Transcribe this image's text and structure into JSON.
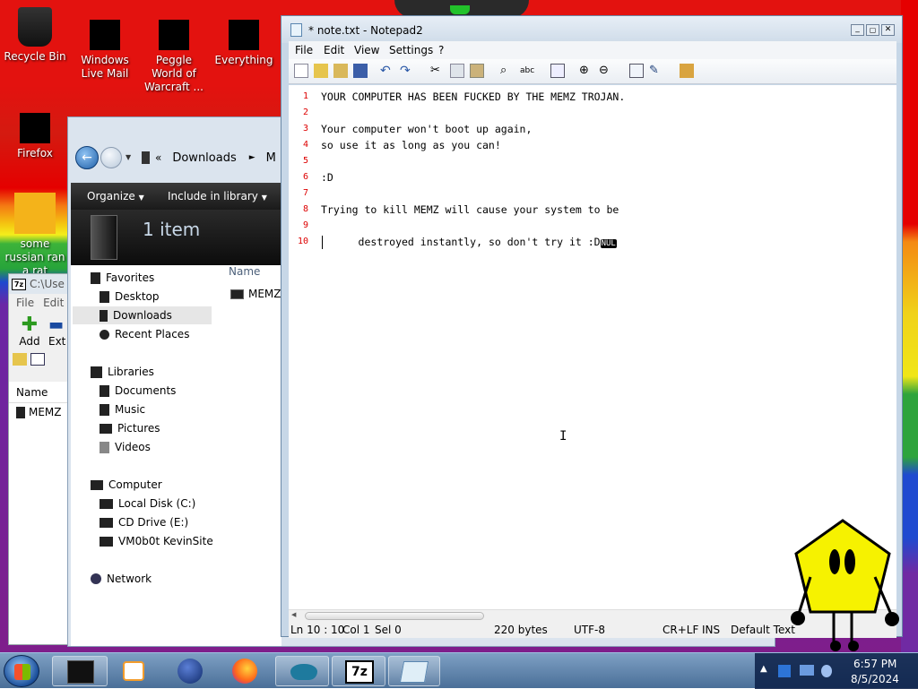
{
  "desktop": {
    "icons": [
      {
        "label": "Recycle Bin"
      },
      {
        "label": "Windows Live Mail"
      },
      {
        "label": "Peggle World of Warcraft ..."
      },
      {
        "label": "Everything"
      },
      {
        "label": "Firefox"
      },
      {
        "label": "some russian ran a rat"
      }
    ]
  },
  "explorer": {
    "breadcrumb": [
      "Downloads",
      "M"
    ],
    "cmd": {
      "organize": "Organize",
      "include": "Include in library"
    },
    "item_count": "1 item",
    "column_name": "Name",
    "files": [
      "MEMZ"
    ],
    "nav": {
      "favorites": "Favorites",
      "favorites_items": [
        "Desktop",
        "Downloads",
        "Recent Places"
      ],
      "libraries": "Libraries",
      "libraries_items": [
        "Documents",
        "Music",
        "Pictures",
        "Videos"
      ],
      "computer": "Computer",
      "computer_items": [
        "Local Disk (C:)",
        "CD Drive (E:)",
        "VM0b0t KevinSite"
      ],
      "network": "Network"
    }
  },
  "sevenzip": {
    "title": "C:\\Use",
    "menu": [
      "File",
      "Edit"
    ],
    "add": "Add",
    "extract": "Ext",
    "column_name": "Name",
    "files": [
      "MEMZ"
    ]
  },
  "notepad": {
    "title": "* note.txt - Notepad2",
    "menu": [
      "File",
      "Edit",
      "View",
      "Settings",
      "?"
    ],
    "lines": [
      "YOUR COMPUTER HAS BEEN FUCKED BY THE MEMZ TROJAN.",
      "",
      "Your computer won't boot up again,",
      "so use it as long as you can!",
      "",
      ":D",
      "",
      "Trying to kill MEMZ will cause your system to be",
      "destroyed instantly, so don't try it :D",
      ""
    ],
    "nul_marker": "NUL",
    "line_numbers": [
      "1",
      "2",
      "3",
      "4",
      "5",
      "6",
      "7",
      "8",
      "9",
      "10"
    ],
    "status": {
      "position": "Ln 10 : 10",
      "col": "Col 1",
      "sel": "Sel 0",
      "size": "220 bytes",
      "encoding": "UTF-8",
      "eol": "CR+LF",
      "mode": "INS",
      "scheme": "Default Text"
    }
  },
  "taskbar": {
    "clock_time": "6:57 PM",
    "clock_date": "8/5/2024"
  }
}
